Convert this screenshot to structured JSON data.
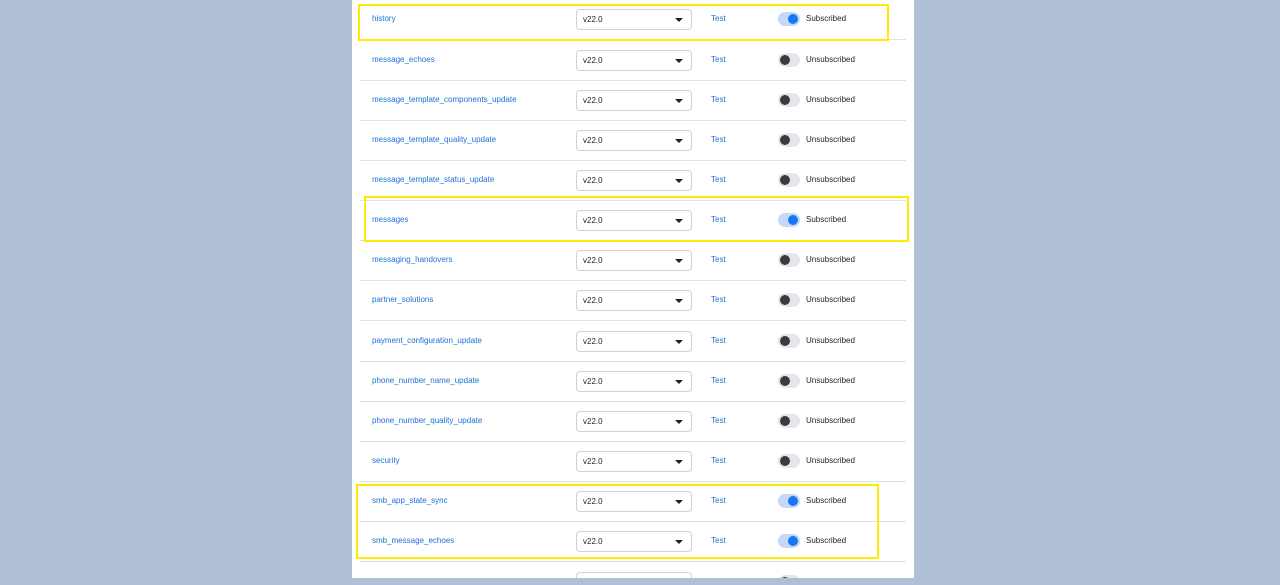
{
  "rows": [
    {
      "field": "history",
      "version": "v22.0",
      "test": "Test",
      "status": "Subscribed",
      "on": true
    },
    {
      "field": "message_echoes",
      "version": "v22.0",
      "test": "Test",
      "status": "Unsubscribed",
      "on": false
    },
    {
      "field": "message_template_components_update",
      "version": "v22.0",
      "test": "Test",
      "status": "Unsubscribed",
      "on": false
    },
    {
      "field": "message_template_quality_update",
      "version": "v22.0",
      "test": "Test",
      "status": "Unsubscribed",
      "on": false
    },
    {
      "field": "message_template_status_update",
      "version": "v22.0",
      "test": "Test",
      "status": "Unsubscribed",
      "on": false
    },
    {
      "field": "messages",
      "version": "v22.0",
      "test": "Test",
      "status": "Subscribed",
      "on": true
    },
    {
      "field": "messaging_handovers",
      "version": "v22.0",
      "test": "Test",
      "status": "Unsubscribed",
      "on": false
    },
    {
      "field": "partner_solutions",
      "version": "v22.0",
      "test": "Test",
      "status": "Unsubscribed",
      "on": false
    },
    {
      "field": "payment_configuration_update",
      "version": "v22.0",
      "test": "Test",
      "status": "Unsubscribed",
      "on": false
    },
    {
      "field": "phone_number_name_update",
      "version": "v22.0",
      "test": "Test",
      "status": "Unsubscribed",
      "on": false
    },
    {
      "field": "phone_number_quality_update",
      "version": "v22.0",
      "test": "Test",
      "status": "Unsubscribed",
      "on": false
    },
    {
      "field": "security",
      "version": "v22.0",
      "test": "Test",
      "status": "Unsubscribed",
      "on": false
    },
    {
      "field": "smb_app_state_sync",
      "version": "v22.0",
      "test": "Test",
      "status": "Subscribed",
      "on": true
    },
    {
      "field": "smb_message_echoes",
      "version": "v22.0",
      "test": "Test",
      "status": "Subscribed",
      "on": true
    }
  ],
  "colors": {
    "highlight": "#ffea00",
    "link": "#1d6fd8",
    "toggle_on": "#1877f2",
    "background": "#aebfd6"
  }
}
